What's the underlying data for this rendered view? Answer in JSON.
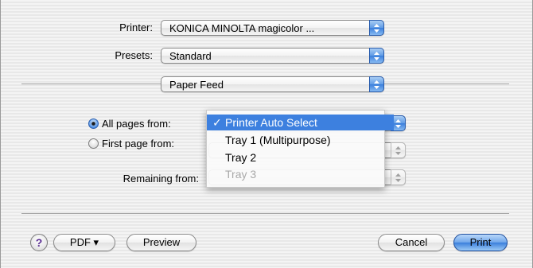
{
  "printer": {
    "label": "Printer:",
    "value": "KONICA MINOLTA magicolor ..."
  },
  "presets": {
    "label": "Presets:",
    "value": "Standard"
  },
  "panel": {
    "value": "Paper Feed"
  },
  "paper_feed": {
    "all_pages_label": "All pages from:",
    "first_page_label": "First page from:",
    "remaining_label": "Remaining from:",
    "selected_option": "all_pages"
  },
  "tray_menu": {
    "items": [
      {
        "label": "Printer Auto Select",
        "checked": true,
        "highlighted": true,
        "enabled": true
      },
      {
        "label": "Tray 1 (Multipurpose)",
        "checked": false,
        "highlighted": false,
        "enabled": true
      },
      {
        "label": "Tray 2",
        "checked": false,
        "highlighted": false,
        "enabled": true
      },
      {
        "label": "Tray 3",
        "checked": false,
        "highlighted": false,
        "enabled": false
      }
    ]
  },
  "buttons": {
    "help": "?",
    "pdf": "PDF ▾",
    "preview": "Preview",
    "cancel": "Cancel",
    "print": "Print"
  },
  "colors": {
    "accent": "#3d80df",
    "default_button": "#3a7edc"
  }
}
